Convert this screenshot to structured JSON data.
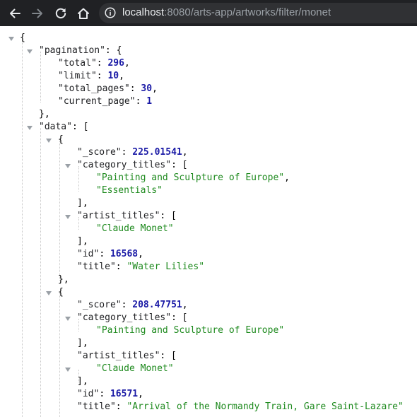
{
  "browser": {
    "url_host": "localhost",
    "url_path": ":8080/arts-app/artworks/filter/monet"
  },
  "json": {
    "open_brace": "{",
    "pagination_key": "\"pagination\"",
    "total_key": "\"total\"",
    "total_value": "296",
    "limit_key": "\"limit\"",
    "limit_value": "10",
    "total_pages_key": "\"total_pages\"",
    "total_pages_value": "30",
    "current_page_key": "\"current_page\"",
    "current_page_value": "1",
    "data_key": "\"data\"",
    "items": [
      {
        "score_key": "\"_score\"",
        "score": "225.01541",
        "category_titles_key": "\"category_titles\"",
        "category_titles": [
          "\"Painting and Sculpture of Europe\"",
          "\"Essentials\""
        ],
        "artist_titles_key": "\"artist_titles\"",
        "artist_titles": [
          "\"Claude Monet\""
        ],
        "id_key": "\"id\"",
        "id": "16568",
        "title_key": "\"title\"",
        "title": "\"Water Lilies\""
      },
      {
        "score_key": "\"_score\"",
        "score": "208.47751",
        "category_titles_key": "\"category_titles\"",
        "category_titles": [
          "\"Painting and Sculpture of Europe\""
        ],
        "artist_titles_key": "\"artist_titles\"",
        "artist_titles": [
          "\"Claude Monet\""
        ],
        "id_key": "\"id\"",
        "id": "16571",
        "title_key": "\"title\"",
        "title": "\"Arrival of the Normandy Train, Gare Saint-Lazare\""
      }
    ]
  },
  "icons": {
    "back": "arrow-left",
    "forward": "arrow-right",
    "reload": "refresh",
    "home": "house",
    "info": "info-circle"
  },
  "colors": {
    "toolbar": "#202124",
    "urlbar": "#303134",
    "key": "#202124",
    "number": "#1a1aa6",
    "string": "#1e8a1e"
  }
}
